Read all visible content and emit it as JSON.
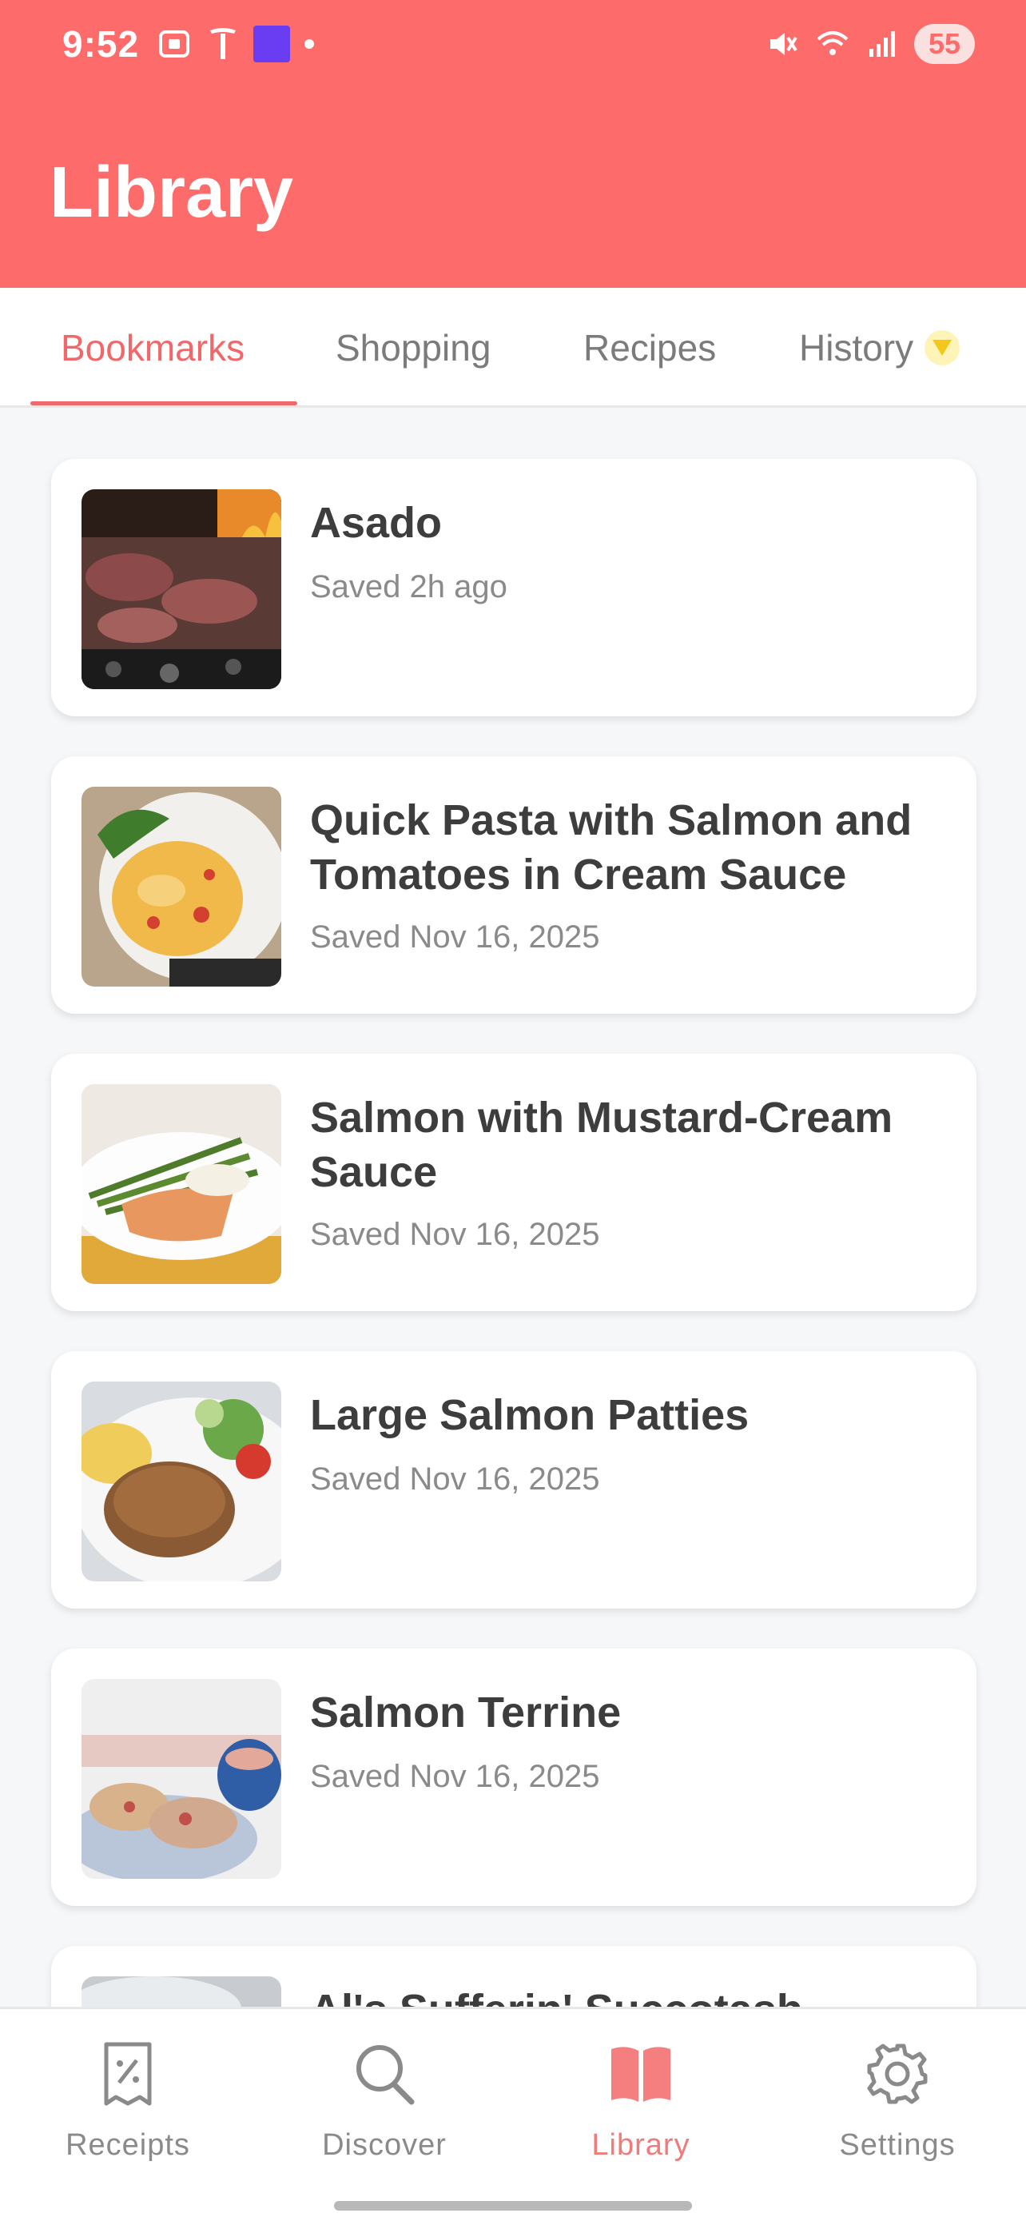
{
  "status_bar": {
    "time": "9:52",
    "battery": "55"
  },
  "header": {
    "title": "Library",
    "color": "#fe6b6b"
  },
  "tabs": [
    {
      "label": "Bookmarks",
      "active": true
    },
    {
      "label": "Shopping",
      "active": false
    },
    {
      "label": "Recipes",
      "active": false
    },
    {
      "label": "History",
      "active": false,
      "badge_icon": "gem-icon"
    }
  ],
  "bookmarks": [
    {
      "title": "Asado",
      "saved": "Saved 2h ago",
      "image": "grilled-meat"
    },
    {
      "title": "Quick Pasta with Salmon and Tomatoes in Cream Sauce",
      "saved": "Saved Nov 16, 2025",
      "image": "pasta-plate"
    },
    {
      "title": "Salmon with Mustard-Cream Sauce",
      "saved": "Saved Nov 16, 2025",
      "image": "salmon-asparagus"
    },
    {
      "title": "Large Salmon Patties",
      "saved": "Saved Nov 16, 2025",
      "image": "salmon-patty"
    },
    {
      "title": "Salmon Terrine",
      "saved": "Saved Nov 16, 2025",
      "image": "salmon-terrine"
    },
    {
      "title": "Al's Sufferin' Succotash",
      "saved": "",
      "image": "succotash"
    }
  ],
  "bottom_nav": [
    {
      "label": "Receipts",
      "icon": "receipt-icon",
      "active": false
    },
    {
      "label": "Discover",
      "icon": "search-icon",
      "active": false
    },
    {
      "label": "Library",
      "icon": "book-icon",
      "active": true
    },
    {
      "label": "Settings",
      "icon": "gear-icon",
      "active": false
    }
  ],
  "accent": "#f0686a"
}
